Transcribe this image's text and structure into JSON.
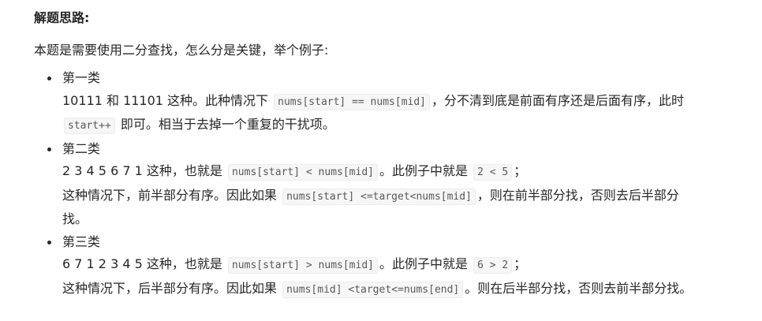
{
  "heading": "解题思路:",
  "intro": "本题是需要使用二分查找，怎么分是关键，举个例子:",
  "cases": [
    {
      "title": "第一类",
      "line1_a": "10111 和 11101 这种。此种情况下",
      "line1_code": "nums[start] == nums[mid]",
      "line1_b": "，分不清到底是前面有序还是后面有序，此时",
      "line1_code2": "start++",
      "line1_c": "即可。相当于去掉一个重复的干扰项。"
    },
    {
      "title": "第二类",
      "line1_a": "2 3 4 5 6 7 1 这种，也就是",
      "line1_code": "nums[start] < nums[mid]",
      "line1_b": "。此例子中就是",
      "line1_code2": "2 < 5",
      "line1_c": "；",
      "line2_a": "这种情况下，前半部分有序。因此如果",
      "line2_code": "nums[start] <=target<nums[mid]",
      "line2_b": "，则在前半部分找，否则去后半部分找。"
    },
    {
      "title": "第三类",
      "line1_a": "6 7 1 2 3 4 5 这种，也就是",
      "line1_code": "nums[start] > nums[mid]",
      "line1_b": "。此例子中就是",
      "line1_code2": "6 > 2",
      "line1_c": "；",
      "line2_a": "这种情况下，后半部分有序。因此如果",
      "line2_code": "nums[mid] <target<=nums[end]",
      "line2_b": "。则在后半部分找，否则去前半部分找。"
    }
  ]
}
